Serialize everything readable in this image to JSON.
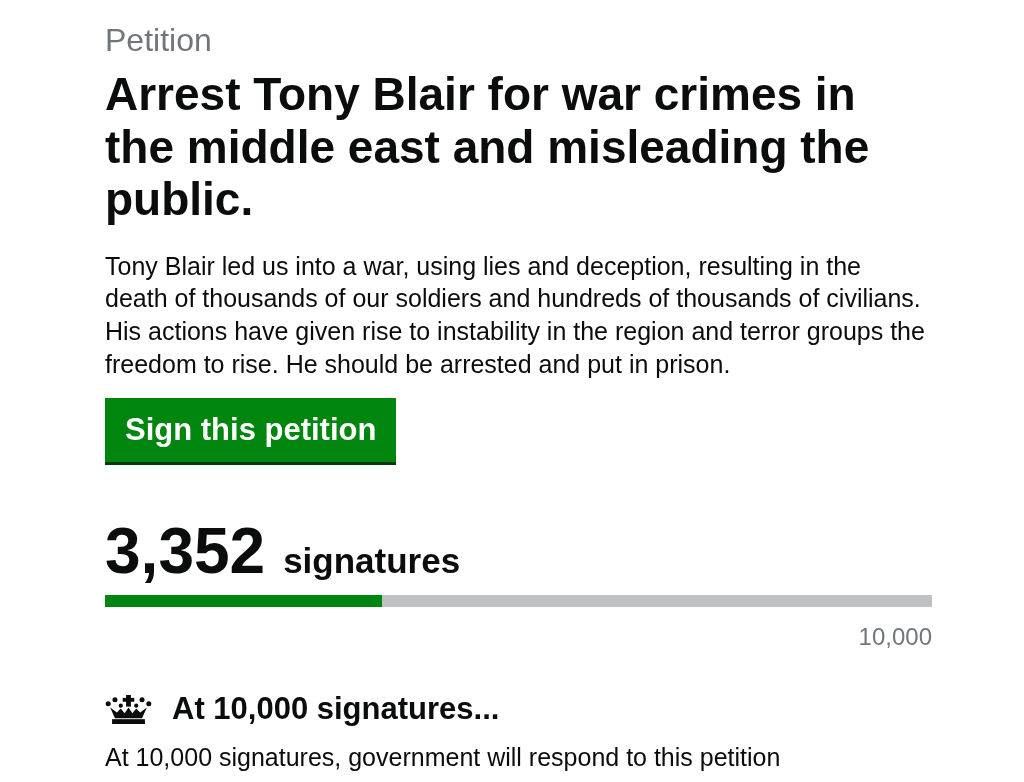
{
  "header": {
    "label": "Petition",
    "title": "Arrest Tony Blair for war crimes in the middle east and misleading the public."
  },
  "description": "Tony Blair led us into a war, using lies and deception, resulting in the death of thousands of our soldiers and hundreds of thousands of civilians. His actions have given rise to instability in the region and terror groups the freedom to rise. He should be arrested and put in prison.",
  "sign_button": "Sign this petition",
  "signatures": {
    "count": "3,352",
    "unit": "signatures",
    "progress": {
      "level": 0.3352
    },
    "target": "10,000"
  },
  "threshold": {
    "heading": "At 10,000 signatures...",
    "text": "At 10,000 signatures, government will respond to this petition"
  }
}
